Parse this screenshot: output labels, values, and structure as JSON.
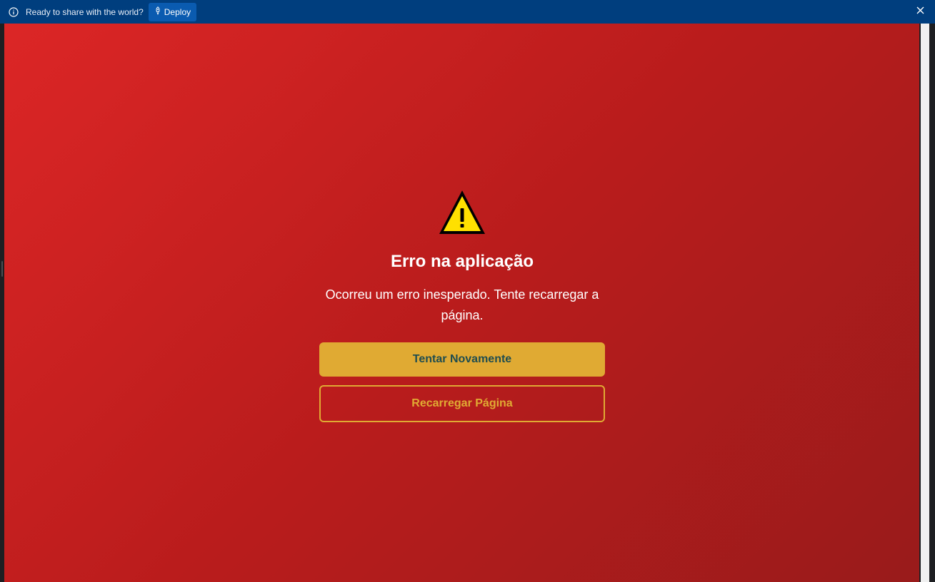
{
  "banner": {
    "message": "Ready to share with the world?",
    "deploy_label": "Deploy",
    "info_icon": "info-icon",
    "deploy_icon": "rocket-icon",
    "close_icon": "close-icon",
    "background_color": "#003e7e"
  },
  "error_page": {
    "icon": "warning-icon",
    "title": "Erro na aplicação",
    "message": "Ocorreu um erro inesperado. Tente recarregar a página.",
    "retry_button_label": "Tentar Novamente",
    "reload_button_label": "Recarregar Página",
    "background_gradient": [
      "#dc2626",
      "#991b1b"
    ],
    "accent_color": "#e0aa33",
    "primary_button_text_color": "#1f4d4f"
  }
}
